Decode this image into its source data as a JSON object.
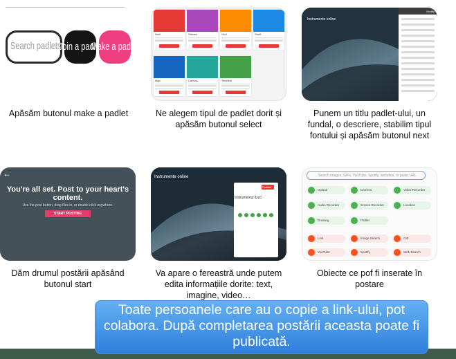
{
  "captions": {
    "step1": "Apăsăm butonul make a padlet",
    "step2": "Ne alegem tipul de padlet dorit și apăsăm butonul select",
    "step3": "Punem un titlu padlet-ului, un fundal, o descriere, stabilim tipul fontului și apăsăm butonul next",
    "step4": "Dăm drumul postării apăsând butonul start",
    "step5": "Va apare o fereastră unde putem edita informațiile dorite: text, imagine, video…",
    "step6": "Obiecte ce pof fi inserate în postare"
  },
  "panel1": {
    "search_placeholder": "Search padlets",
    "join_label": "Join a padlet",
    "make_label": "Make a padlet"
  },
  "panel2": {
    "cards": [
      "Wall",
      "Stream",
      "Grid",
      "Shelf",
      "Map",
      "Canvas",
      "Timeline"
    ],
    "select_label": "SELECT",
    "colors": [
      "#e53935",
      "#ab47bc",
      "#fb8c00",
      "#1e88e5",
      "#1565c0",
      "#26a69a",
      "#43a047"
    ]
  },
  "panel3": {
    "title": "Instrumente online",
    "sidebar_header": "Modify"
  },
  "panel4": {
    "headline": "You're all set. Post to your heart's content.",
    "hint": "Use the post button, drag files in, or double click anywhere.",
    "start_label": "START POSTING"
  },
  "panel5": {
    "title": "Instrumente online",
    "window_title": "Instrumentul lizzo",
    "publish_label": "Publish"
  },
  "panel6": {
    "search_placeholder": "Search images, GIFs, YouTube, Spotify, websites, or paste URL",
    "green_items": [
      "Upload",
      "Camera",
      "Video Recorder",
      "Audio Recorder",
      "Screen Recorder",
      "Location",
      "Drawing",
      "Padlet"
    ],
    "orange_items": [
      "Link",
      "Image Search",
      "GIF",
      "YouTube",
      "Spotify",
      "Web Search"
    ]
  },
  "callout_text": "Toate persoanele care au o copie a link-ului, pot colabora. După completarea postării aceasta poate fi publicată."
}
